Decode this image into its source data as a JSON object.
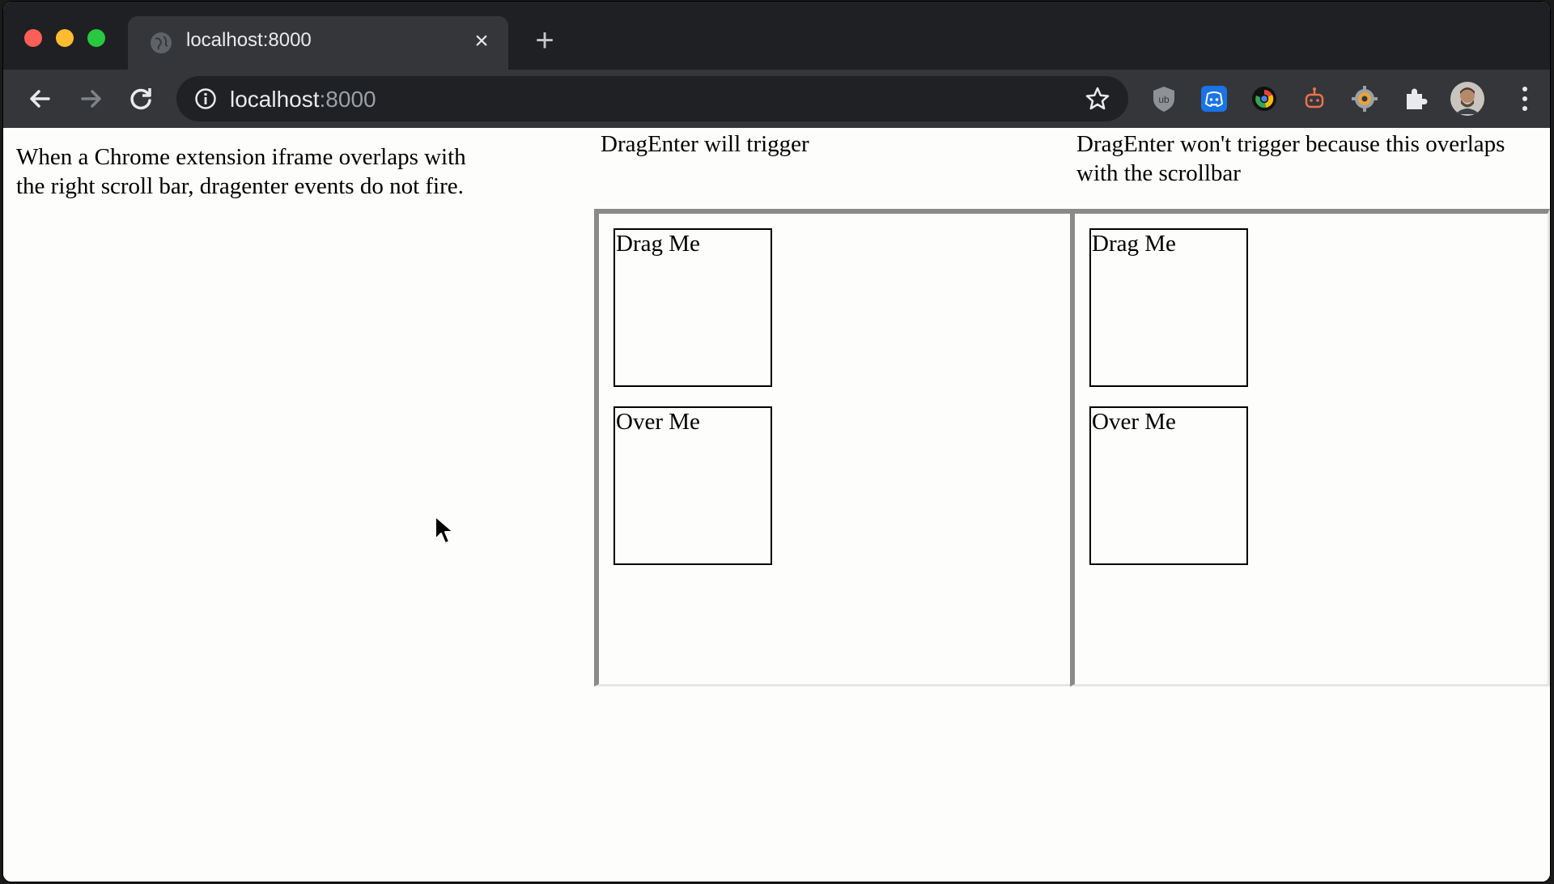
{
  "browser": {
    "tab_title": "localhost:8000",
    "url_host": "localhost",
    "url_port": ":8000",
    "new_tab_label": "+",
    "close_tab_label": "×"
  },
  "extensions": [
    {
      "name": "ublock-icon",
      "color": "#8e9196"
    },
    {
      "name": "discord-icon",
      "color": "#1a73e8"
    },
    {
      "name": "chrome-circle-icon",
      "color": "#000000"
    },
    {
      "name": "robot-icon",
      "color": "#e8734a"
    },
    {
      "name": "gear-extension-icon",
      "color": "#e8a33d"
    },
    {
      "name": "puzzle-icon",
      "color": "#e8eaed"
    }
  ],
  "page": {
    "intro": "When a Chrome extension iframe overlaps with the right scroll bar, dragenter events do not fire.",
    "left_label": "DragEnter will trigger",
    "right_label": "DragEnter won't trigger because this overlaps with the scrollbar",
    "left_frame": {
      "drag_label": "Drag Me",
      "over_label": "Over Me"
    },
    "right_frame": {
      "drag_label": "Drag Me",
      "over_label": "Over Me"
    }
  }
}
